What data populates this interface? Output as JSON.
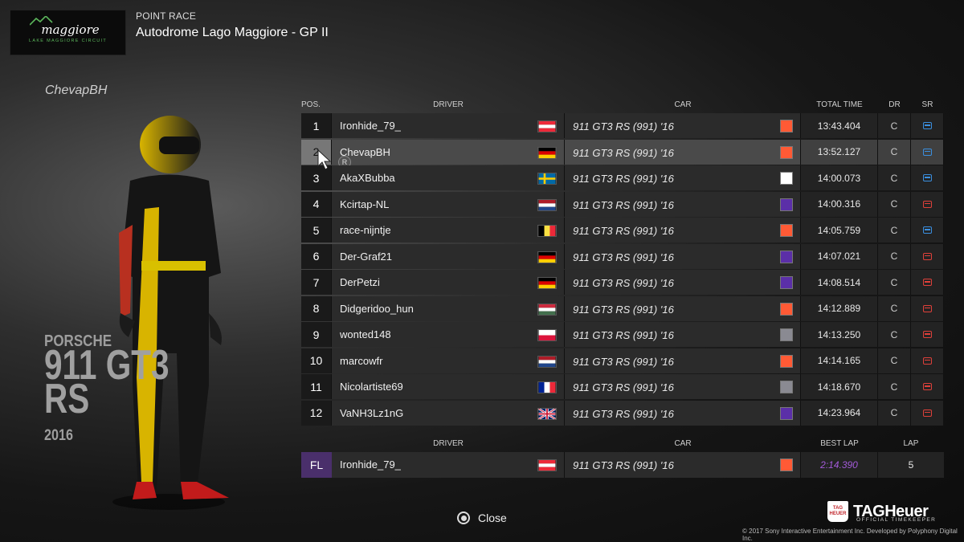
{
  "header": {
    "logo_main": "maggiore",
    "logo_sub": "LAKE MAGGIORE CIRCUIT",
    "race_type": "POINT RACE",
    "race_name": "Autodrome Lago Maggiore - GP II"
  },
  "player": {
    "name": "ChevapBH",
    "car_maker": "PORSCHE",
    "car_model_line1": "911 GT3",
    "car_model_line2": "RS",
    "car_year": "2016"
  },
  "table": {
    "headers": {
      "pos": "POS.",
      "driver": "DRIVER",
      "car": "CAR",
      "total_time": "TOTAL TIME",
      "dr": "DR",
      "sr": "SR"
    },
    "selected_row": 2,
    "selected_badge": "R",
    "rows": [
      {
        "pos": "1",
        "driver": "Ironhide_79_",
        "flag": "austria",
        "car": "911 GT3 RS (991) '16",
        "car_color": "#ff5a35",
        "time": "13:43.404",
        "dr": "C",
        "sr_color": "#3a8fe0"
      },
      {
        "pos": "2",
        "driver": "ChevapBH",
        "flag": "germany",
        "car": "911 GT3 RS (991) '16",
        "car_color": "#ff5a35",
        "time": "13:52.127",
        "dr": "C",
        "sr_color": "#3a8fe0"
      },
      {
        "pos": "3",
        "driver": "AkaXBubba",
        "flag": "sweden",
        "car": "911 GT3 RS (991) '16",
        "car_color": "#ffffff",
        "time": "14:00.073",
        "dr": "C",
        "sr_color": "#3a8fe0"
      },
      {
        "pos": "4",
        "driver": "Kcirtap-NL",
        "flag": "netherlands",
        "car": "911 GT3 RS (991) '16",
        "car_color": "#5b2fa8",
        "time": "14:00.316",
        "dr": "C",
        "sr_color": "#e0403a"
      },
      {
        "pos": "5",
        "driver": "race-nijntje",
        "flag": "belgium",
        "car": "911 GT3 RS (991) '16",
        "car_color": "#ff5a35",
        "time": "14:05.759",
        "dr": "C",
        "sr_color": "#3a8fe0"
      },
      {
        "pos": "6",
        "driver": "Der-Graf21",
        "flag": "germany",
        "car": "911 GT3 RS (991) '16",
        "car_color": "#5b2fa8",
        "time": "14:07.021",
        "dr": "C",
        "sr_color": "#e0403a"
      },
      {
        "pos": "7",
        "driver": "DerPetzi",
        "flag": "germany",
        "car": "911 GT3 RS (991) '16",
        "car_color": "#5b2fa8",
        "time": "14:08.514",
        "dr": "C",
        "sr_color": "#e0403a"
      },
      {
        "pos": "8",
        "driver": "Didgeridoo_hun",
        "flag": "hungary",
        "car": "911 GT3 RS (991) '16",
        "car_color": "#ff5a35",
        "time": "14:12.889",
        "dr": "C",
        "sr_color": "#e0403a"
      },
      {
        "pos": "9",
        "driver": "wonted148",
        "flag": "poland",
        "car": "911 GT3 RS (991) '16",
        "car_color": "#8a8a92",
        "time": "14:13.250",
        "dr": "C",
        "sr_color": "#e0403a"
      },
      {
        "pos": "10",
        "driver": "marcowfr",
        "flag": "netherlands",
        "car": "911 GT3 RS (991) '16",
        "car_color": "#ff5a35",
        "time": "14:14.165",
        "dr": "C",
        "sr_color": "#e0403a"
      },
      {
        "pos": "11",
        "driver": "Nicolartiste69",
        "flag": "france",
        "car": "911 GT3 RS (991) '16",
        "car_color": "#8a8a92",
        "time": "14:18.670",
        "dr": "C",
        "sr_color": "#e0403a"
      },
      {
        "pos": "12",
        "driver": "VaNH3Lz1nG",
        "flag": "uk",
        "car": "911 GT3 RS (991) '16",
        "car_color": "#5b2fa8",
        "time": "14:23.964",
        "dr": "C",
        "sr_color": "#e0403a"
      }
    ]
  },
  "fastest_lap": {
    "headers": {
      "driver": "DRIVER",
      "car": "CAR",
      "best_lap": "BEST LAP",
      "lap": "LAP"
    },
    "label": "FL",
    "driver": "Ironhide_79_",
    "flag": "austria",
    "car": "911 GT3 RS (991) '16",
    "car_color": "#ff5a35",
    "best_lap": "2:14.390",
    "lap": "5"
  },
  "footer": {
    "close_label": "Close",
    "tag_brand": "TAGHeuer",
    "tag_shield_top": "TAG",
    "tag_shield_bottom": "HEUER",
    "tag_sub": "OFFICIAL TIMEKEEPER",
    "copyright": "© 2017 Sony Interactive Entertainment Inc. Developed by Polyphony Digital Inc."
  }
}
